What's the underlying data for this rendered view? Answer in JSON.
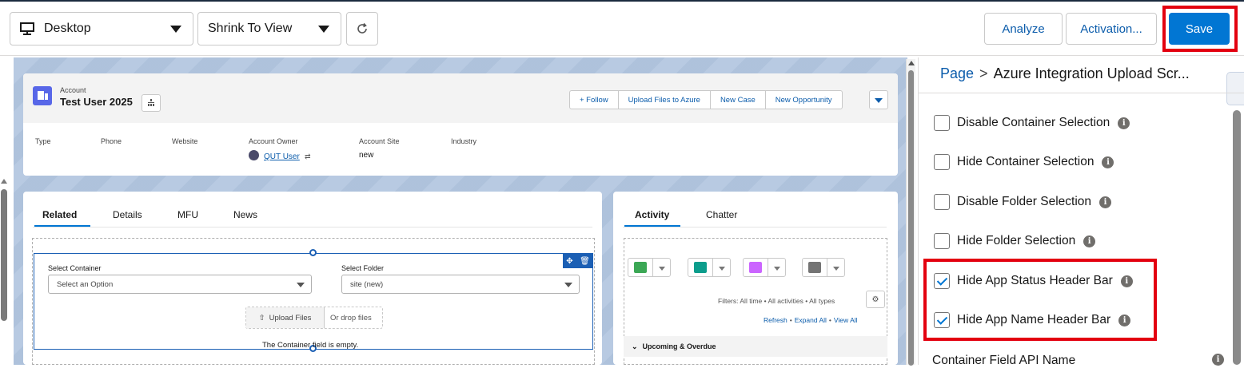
{
  "toolbar": {
    "device_value": "Desktop",
    "view_value": "Shrink To View",
    "analyze_label": "Analyze",
    "activation_label": "Activation...",
    "save_label": "Save"
  },
  "record": {
    "object_label": "Account",
    "name": "Test User 2025",
    "actions": [
      "+ Follow",
      "Upload Files to Azure",
      "New Case",
      "New Opportunity"
    ],
    "fields": {
      "type_label": "Type",
      "phone_label": "Phone",
      "website_label": "Website",
      "owner_label": "Account Owner",
      "owner_value": "QUT User",
      "site_label": "Account Site",
      "site_value": "new",
      "industry_label": "Industry"
    }
  },
  "related": {
    "tabs": [
      "Related",
      "Details",
      "MFU",
      "News"
    ],
    "container_label": "Select Container",
    "container_placeholder": "Select an Option",
    "folder_label": "Select Folder",
    "folder_value": "site (new)",
    "upload_label": "Upload Files",
    "drop_label": "Or drop files",
    "error_text": "The Container field is empty."
  },
  "activity": {
    "tabs": [
      "Activity",
      "Chatter"
    ],
    "filters_text": "Filters: All time • All activities • All types",
    "refresh_label": "Refresh",
    "expand_label": "Expand All",
    "view_label": "View All",
    "upcoming_label": "Upcoming & Overdue"
  },
  "properties": {
    "crumb_page": "Page",
    "crumb_sep": ">",
    "crumb_title": "Azure Integration Upload Scr...",
    "checkboxes": [
      {
        "label": "Disable Container Selection",
        "checked": false
      },
      {
        "label": "Hide Container Selection",
        "checked": false
      },
      {
        "label": "Disable Folder Selection",
        "checked": false
      },
      {
        "label": "Hide Folder Selection",
        "checked": false
      },
      {
        "label": "Hide App Status Header Bar",
        "checked": true
      },
      {
        "label": "Hide App Name Header Bar",
        "checked": true
      }
    ],
    "container_field_label": "Container Field API Name"
  },
  "icons": {
    "monitor": "monitor-icon",
    "refresh": "refresh-icon",
    "info": "info-icon",
    "gear": "gear-icon"
  },
  "colors": {
    "brand": "#0176d3",
    "highlight": "#e3000f",
    "link": "#0b5cab"
  }
}
